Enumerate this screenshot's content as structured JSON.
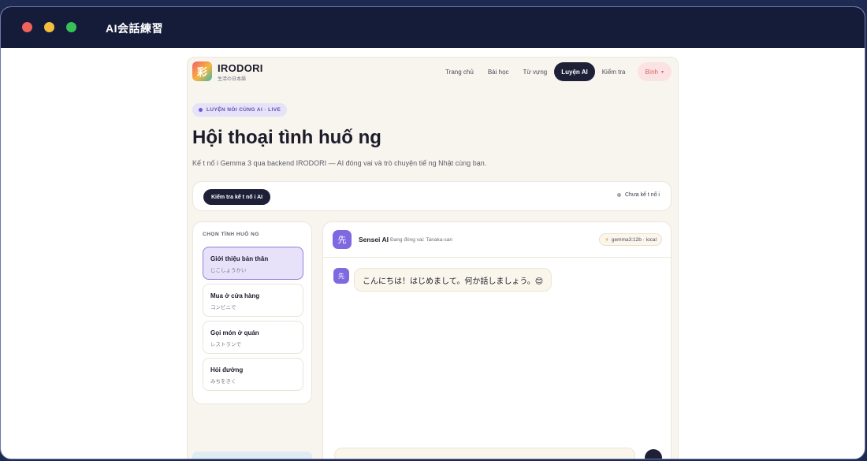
{
  "window": {
    "title": "AI会話練習"
  },
  "brand": {
    "logo_glyph": "彩",
    "name": "IRODORI",
    "tagline": "生活の日本語"
  },
  "nav": {
    "items": [
      "Trang chủ",
      "Bài học",
      "Từ vựng",
      "Luyện AI",
      "Kiểm tra"
    ],
    "active": "Luyện AI",
    "user": "Bình",
    "user_caret": "▾"
  },
  "hero": {
    "badge": "LUYỆN NÓI CÙNG AI · LIVE",
    "title": "Hội thoại tình huố ng",
    "subtitle": "Kế t nố i Gemma 3 qua backend IRODORI — AI đóng vai và trò chuyện tiế ng Nhật cùng bạn."
  },
  "connection": {
    "check_button": "Kiểm tra kế t nố i AI",
    "status": "Chưa kế t nố i"
  },
  "scenarios": {
    "heading": "CHỌN TÌNH HUỐ NG",
    "items": [
      {
        "title": "Giới thiệu bản thân",
        "subtitle": "じこしょうかい",
        "active": true
      },
      {
        "title": "Mua ở cửa hàng",
        "subtitle": "コンビニで",
        "active": false
      },
      {
        "title": "Gọi món ở quán",
        "subtitle": "レストランで",
        "active": false
      },
      {
        "title": "Hỏi đường",
        "subtitle": "みちをきく",
        "active": false
      }
    ]
  },
  "chat": {
    "avatar_glyph": "先",
    "name": "Sensei AI",
    "role": "Đang đóng vai: Tanaka-san",
    "model": "gemma3:12b · local",
    "messages": [
      {
        "sender": "ai",
        "avatar": "先",
        "text": "こんにちは！はじめまして。何か話しましょう。😊"
      }
    ]
  },
  "colors": {
    "accent": "#7e69e0",
    "dark": "#1d2036",
    "page_bg": "#f8f5ee",
    "titlebar": "#141c3a"
  }
}
